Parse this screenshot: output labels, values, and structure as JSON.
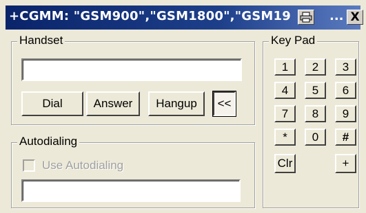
{
  "window": {
    "title": "+CGMM: \"GSM900\",\"GSM1800\",\"GSM19",
    "title_suffix": "...",
    "close_label": "X"
  },
  "handset": {
    "group_label": "Handset",
    "number_value": "",
    "dial_label": "Dial",
    "answer_label": "Answer",
    "hangup_label": "Hangup",
    "collapse_label": "<<"
  },
  "autodialing": {
    "group_label": "Autodialing",
    "checkbox_label": "Use Autodialing",
    "checked": false,
    "input_value": ""
  },
  "keypad": {
    "group_label": "Key Pad",
    "keys": [
      "1",
      "2",
      "3",
      "4",
      "5",
      "6",
      "7",
      "8",
      "9",
      "*",
      "0",
      "#"
    ],
    "clear_label": "Clr",
    "plus_label": "+"
  },
  "colors": {
    "titlebar": "#0a246a",
    "face": "#ece9d8"
  }
}
